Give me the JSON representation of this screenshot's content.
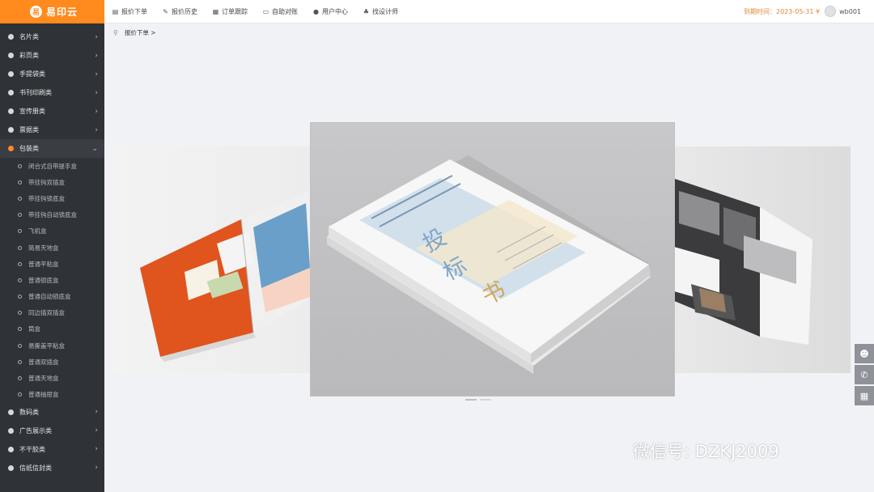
{
  "app": {
    "logo_text": "易印云",
    "logo_glyph": "易"
  },
  "topbar": {
    "nav": [
      {
        "label": "报价下单",
        "icon": "quote-icon"
      },
      {
        "label": "报价历史",
        "icon": "edit-icon"
      },
      {
        "label": "订单跟踪",
        "icon": "calendar-icon"
      },
      {
        "label": "自助对账",
        "icon": "monitor-icon"
      },
      {
        "label": "用户中心",
        "icon": "user-icon"
      },
      {
        "label": "找设计师",
        "icon": "group-icon"
      }
    ],
    "expire_text": "到期时间：2023-05-31 ¥",
    "username": "wb001"
  },
  "breadcrumb": {
    "label": "报价下单 >"
  },
  "sidebar": {
    "categories_top": [
      {
        "label": "名片类"
      },
      {
        "label": "彩页类"
      },
      {
        "label": "手提袋类"
      },
      {
        "label": "书刊印刷类"
      },
      {
        "label": "宣传册类"
      },
      {
        "label": "票据类"
      }
    ],
    "active_category": {
      "label": "包装类"
    },
    "sub_items": [
      "闭合式自带提手盒",
      "带挂钩双插盒",
      "带挂钩锁底盒",
      "带挂钩自动锁底盒",
      "飞机盒",
      "简易天地盒",
      "普通平粘盒",
      "普通锁底盒",
      "普通自动锁底盒",
      "同边插双插盒",
      "筒盒",
      "易撕盖平粘盒",
      "普通双插盒",
      "普通天地盒",
      "普通抽屉盒"
    ],
    "categories_bottom": [
      {
        "label": "数码类"
      },
      {
        "label": "广告展示类"
      },
      {
        "label": "不干胶类"
      },
      {
        "label": "信纸信封类"
      }
    ]
  },
  "carousel": {
    "center_book": {
      "big_chars": [
        "投",
        "标",
        "书"
      ]
    }
  },
  "float_buttons": [
    "qq-icon",
    "phone-icon",
    "qrcode-icon"
  ],
  "watermark": "微信号: DZKJ2009"
}
